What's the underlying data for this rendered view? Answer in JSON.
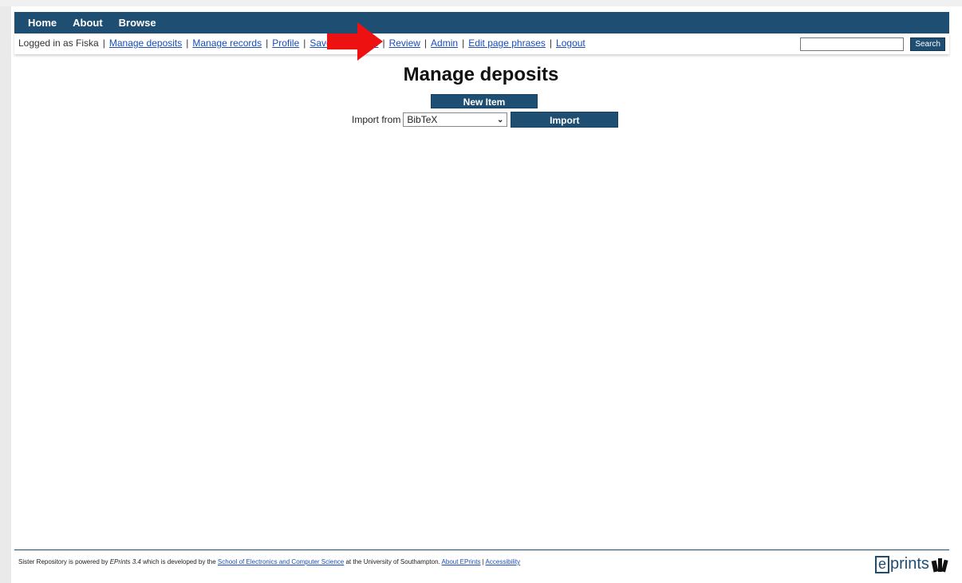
{
  "nav": {
    "items": [
      "Home",
      "About",
      "Browse"
    ]
  },
  "userbar": {
    "logged_in": "Logged in as Fiska",
    "links": [
      "Manage deposits",
      "Manage records",
      "Profile",
      "Saved searches",
      "Review",
      "Admin",
      "Edit page phrases",
      "Logout"
    ],
    "search_value": "",
    "search_button": "Search"
  },
  "main": {
    "title": "Manage deposits",
    "new_item": "New Item",
    "import_label": "Import from",
    "import_selected": "BibTeX",
    "import_button": "Import"
  },
  "footer": {
    "t1": "Sister Repository is powered by ",
    "eprints_version": "EPrints 3.4",
    "t2": " which is developed by the ",
    "ecs_link": "School of Electronics and Computer Science",
    "t3": " at the University of Southampton. ",
    "about_link": "About EPrints",
    "sep": " | ",
    "accessibility_link": "Accessibility"
  },
  "logo": {
    "e": "e",
    "text": "prints"
  },
  "colors": {
    "brand": "#1f4e73",
    "link": "#1a4db8",
    "arrow": "#ee1111"
  }
}
